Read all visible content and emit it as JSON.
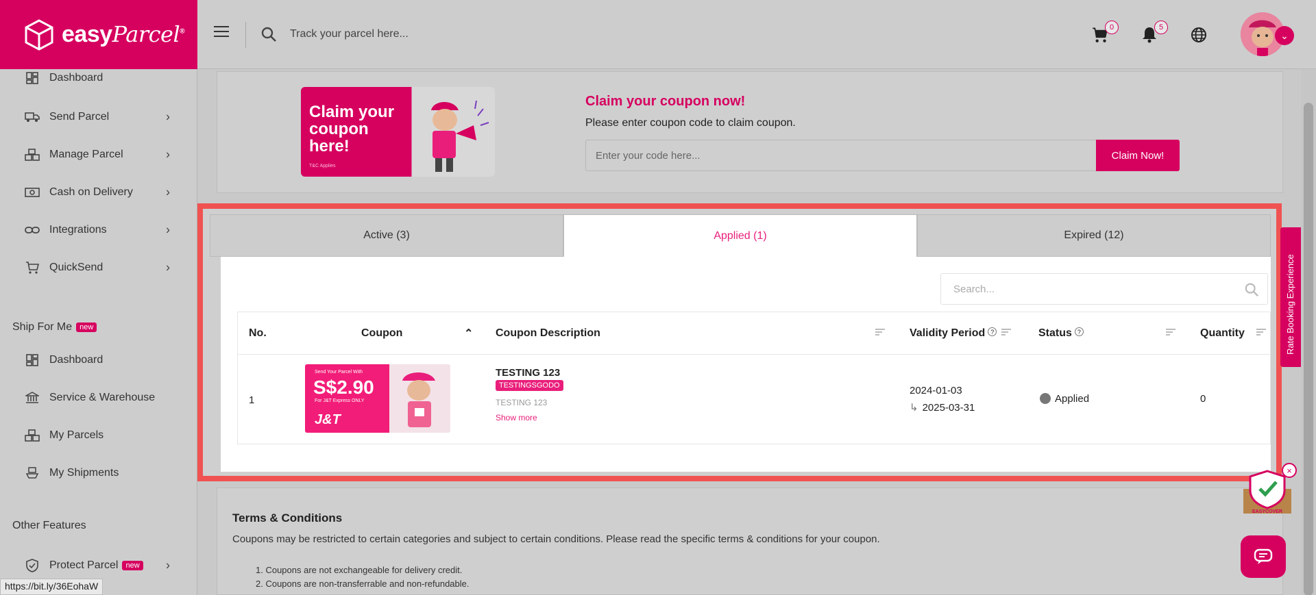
{
  "brand": {
    "name": "easy",
    "script": "Parcel",
    "mark": "®",
    "accent": "#d6005f"
  },
  "header": {
    "search_placeholder": "Track your parcel here...",
    "cart_count": "0",
    "notification_count": "5",
    "icons": [
      "menu-icon",
      "search-icon",
      "cart-icon",
      "bell-icon",
      "globe-icon"
    ]
  },
  "sidebar": {
    "items": [
      {
        "label": "Dashboard",
        "icon": "dashboard-icon"
      },
      {
        "label": "Send Parcel",
        "icon": "truck-icon"
      },
      {
        "label": "Manage Parcel",
        "icon": "boxes-icon"
      },
      {
        "label": "Cash on Delivery",
        "icon": "cash-icon"
      },
      {
        "label": "Integrations",
        "icon": "link-icon"
      },
      {
        "label": "QuickSend",
        "icon": "cart-icon"
      }
    ],
    "ship_for_me": {
      "title": "Ship For Me",
      "badge": "new",
      "items": [
        {
          "label": "Dashboard",
          "icon": "dashboard-icon"
        },
        {
          "label": "Service & Warehouse",
          "icon": "bank-icon"
        },
        {
          "label": "My Parcels",
          "icon": "boxes-icon"
        },
        {
          "label": "My Shipments",
          "icon": "ship-icon"
        }
      ]
    },
    "other_features": {
      "title": "Other Features",
      "items": [
        {
          "label": "Protect Parcel",
          "badge": "new",
          "icon": "shield-icon"
        }
      ]
    }
  },
  "claim": {
    "banner_text": "Claim your coupon here!",
    "banner_tc": "T&C Applies",
    "title": "Claim your coupon now!",
    "subtitle": "Please enter coupon code to claim coupon.",
    "input_placeholder": "Enter your code here...",
    "button_label": "Claim Now!"
  },
  "tabs": [
    {
      "label": "Active (3)",
      "active": false
    },
    {
      "label": "Applied (1)",
      "active": true
    },
    {
      "label": "Expired (12)",
      "active": false
    }
  ],
  "table": {
    "search_placeholder": "Search...",
    "columns": [
      "No.",
      "Coupon",
      "Coupon Description",
      "Validity Period",
      "Status",
      "Quantity"
    ],
    "rows": [
      {
        "no": "1",
        "coupon_image": {
          "top_text": "Send Your Parcel With",
          "price": "S$2.90",
          "sub_text": "For J&T Express ONLY",
          "brand": "J&T"
        },
        "title": "TESTING 123",
        "code": "TESTINGSGODO",
        "description": "TESTING 123",
        "show_more": "Show more",
        "valid_from": "2024-01-03",
        "valid_to": "2025-03-31",
        "status": "Applied",
        "quantity": "0"
      }
    ]
  },
  "terms": {
    "title": "Terms & Conditions",
    "intro": "Coupons may be restricted to certain categories and subject to certain conditions. Please read the specific terms & conditions for your coupon.",
    "items": [
      "1. Coupons are not exchangeable for delivery credit.",
      "2. Coupons are non-transferrable and non-refundable."
    ]
  },
  "rate_tab": "Rate Booking Experience",
  "easycover_label": "EASYCOVER",
  "status_url": "https://bit.ly/36EohaW"
}
